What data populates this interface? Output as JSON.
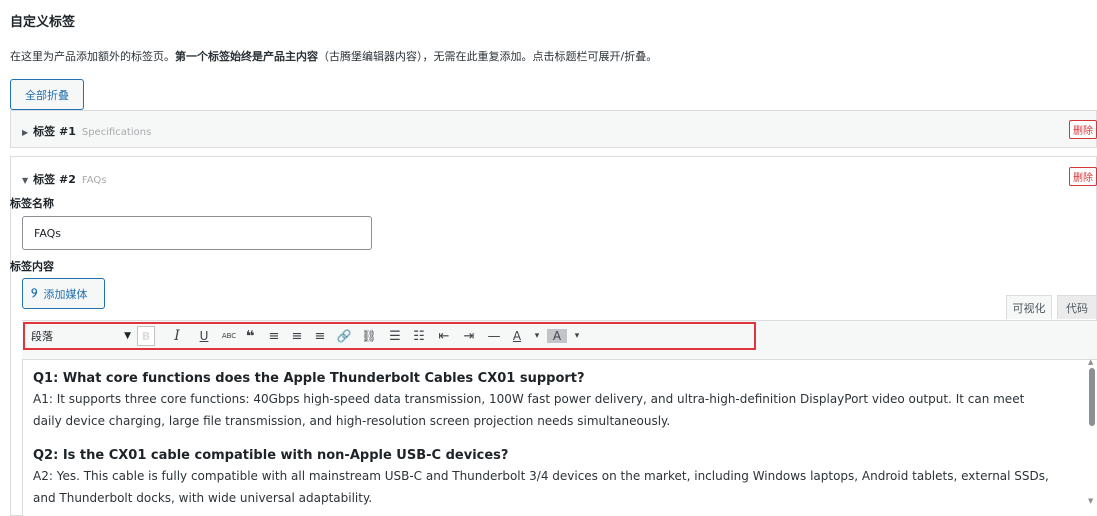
{
  "section": {
    "title": "自定义标签",
    "desc_pre": "在这里为产品添加额外的标签页。",
    "desc_bold": "第一个标签始终是产品主内容",
    "desc_post": "（古腾堡编辑器内容），无需在此重复添加。点击标题栏可展开/折叠。",
    "collapse_all": "全部折叠"
  },
  "tabs": [
    {
      "arrow": "▶",
      "label": "标签 #1",
      "subtitle": "Specifications",
      "delete": "删除"
    },
    {
      "arrow": "▼",
      "label": "标签 #2",
      "subtitle": "FAQs",
      "delete": "删除"
    }
  ],
  "editor": {
    "name_label": "标签名称",
    "name_value": "FAQs",
    "content_label": "标签内容",
    "add_media": "添加媒体",
    "mode_visual": "可视化",
    "mode_code": "代码",
    "format_select": "段落",
    "toolbar": {
      "bold": "B",
      "italic": "I",
      "underline": "U",
      "strike": "ABC",
      "quote": "❝",
      "align_left": "≡",
      "align_center": "≡",
      "align_right": "≡",
      "link": "🔗",
      "unlink": "⛓",
      "ul": "☰",
      "ol": "☷",
      "outdent": "⇤",
      "indent": "⇥",
      "hr": "—",
      "text_color": "A",
      "bg_color": "A",
      "dropdown": "▾"
    }
  },
  "content": {
    "q1": "Q1: What core functions does the Apple Thunderbolt Cables CX01 support?",
    "a1_line1": "A1: It supports three core functions: 40Gbps high-speed data transmission, 100W fast power delivery, and ultra-high-definition DisplayPort video output. It can meet",
    "a1_line2": "daily device charging, large file transmission, and high-resolution screen projection needs simultaneously.",
    "q2": "Q2: Is the CX01 cable compatible with non-Apple USB-C devices?",
    "a2_line1": "A2: Yes. This cable is fully compatible with all mainstream USB-C and Thunderbolt 3/4 devices on the market, including Windows laptops, Android tablets, external SSDs,",
    "a2_line2": "and Thunderbolt docks, with wide universal adaptability."
  }
}
